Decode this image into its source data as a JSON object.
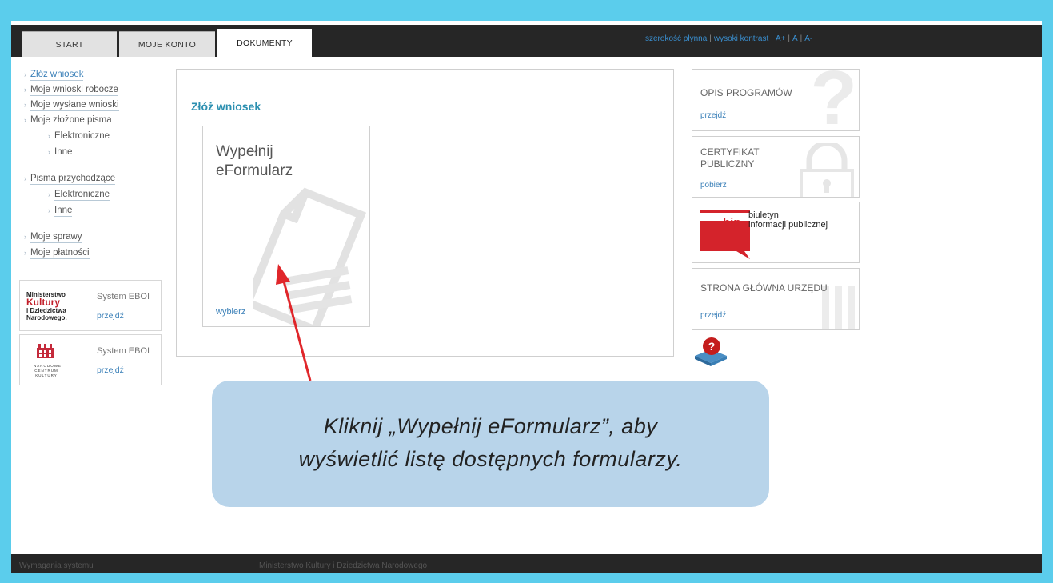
{
  "nav": {
    "tabs": [
      {
        "label": "START"
      },
      {
        "label": "MOJE KONTO"
      },
      {
        "label": "DOKUMENTY"
      }
    ],
    "accessibility": {
      "width": "szerokość płynna",
      "contrast": "wysoki kontrast",
      "font_plus": "A+",
      "font_normal": "A",
      "font_minus": "A-"
    }
  },
  "sidebar": {
    "items": [
      {
        "label": "Złóż wniosek"
      },
      {
        "label": "Moje wnioski robocze"
      },
      {
        "label": "Moje wysłane wnioski"
      },
      {
        "label": "Moje złożone pisma"
      },
      {
        "label": "Elektroniczne"
      },
      {
        "label": "Inne"
      },
      {
        "label": "Pisma przychodzące"
      },
      {
        "label": "Elektroniczne"
      },
      {
        "label": "Inne"
      },
      {
        "label": "Moje sprawy"
      },
      {
        "label": "Moje płatności"
      }
    ],
    "partners": [
      {
        "logo_lines": [
          "Ministerstwo",
          "Kultury",
          "i Dziedzictwa",
          "Narodowego."
        ],
        "system": "System EBOI",
        "link": "przejdź"
      },
      {
        "logo_lines": [
          "NARODOWE",
          "CENTRUM",
          "KULTURY"
        ],
        "system": "System EBOI",
        "link": "przejdź"
      }
    ]
  },
  "main": {
    "title": "Złóż wniosek",
    "tile": {
      "title": "Wypełnij\neFormularz",
      "action": "wybierz"
    }
  },
  "right_cards": [
    {
      "title": "OPIS PROGRAMÓW",
      "action": "przejdź"
    },
    {
      "title": "CERTYFIKAT\nPUBLICZNY",
      "action": "pobierz"
    },
    {
      "title": "biuletyn\ninformacji publicznej",
      "logo": "bip"
    },
    {
      "title": "STRONA GŁÓWNA URZĘDU",
      "action": "przejdź"
    }
  ],
  "callout": {
    "text": "Kliknij „Wypełnij eFormularz”, aby\nwyświetlić listę dostępnych formularzy."
  },
  "footer": {
    "left": "Wymagania systemu",
    "center": "Ministerstwo Kultury i Dziedzictwa Narodowego"
  },
  "colors": {
    "border": "#5bcdec",
    "topbar": "#262626",
    "link": "#3b80b8",
    "title_accent": "#2b8fb0",
    "callout": "#b8d4ea",
    "arrow": "#e0262a",
    "bip_red": "#d4232b"
  }
}
